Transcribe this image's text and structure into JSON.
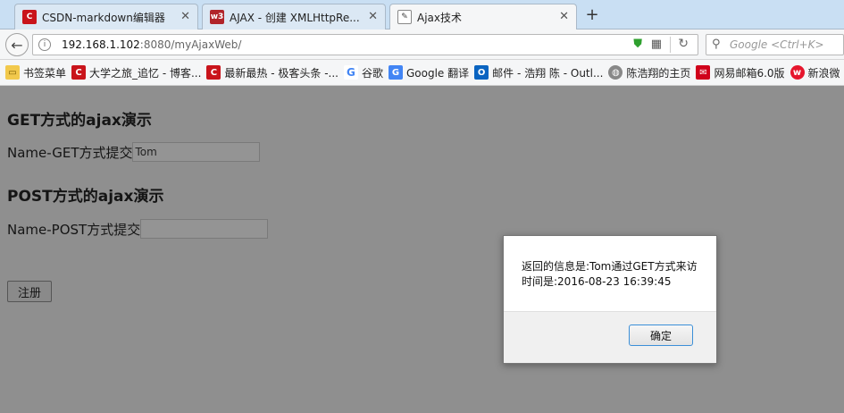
{
  "tabs": [
    {
      "label": "CSDN-markdown编辑器",
      "icon": "csdn-icon",
      "color": "#c9141b"
    },
    {
      "label": "AJAX - 创建 XMLHttpRe...",
      "icon": "w3-icon",
      "color": "#b1242a"
    },
    {
      "label": "Ajax技术",
      "icon": "page-icon",
      "color": "#444444"
    }
  ],
  "nav": {
    "url_host": "192.168.1.102",
    "url_rest": ":8080/myAjaxWeb/",
    "search_placeholder": "Google <Ctrl+K>"
  },
  "bookmarks": [
    {
      "label": "书签菜单",
      "icon": "folder-icon"
    },
    {
      "label": "大学之旅_追忆 - 博客...",
      "icon": "csdn-icon"
    },
    {
      "label": "最新最热 - 极客头条 -...",
      "icon": "csdn-icon"
    },
    {
      "label": "谷歌",
      "icon": "google-icon"
    },
    {
      "label": "Google 翻译",
      "icon": "translate-icon"
    },
    {
      "label": "邮件 - 浩翔 陈 - Outl...",
      "icon": "outlook-icon"
    },
    {
      "label": "陈浩翔的主页",
      "icon": "globe-icon"
    },
    {
      "label": "网易邮箱6.0版",
      "icon": "netease-icon"
    },
    {
      "label": "新浪微",
      "icon": "weibo-icon"
    }
  ],
  "page": {
    "get_heading": "GET方式的ajax演示",
    "get_label": "Name-GET方式提交",
    "get_value": "Tom",
    "post_heading": "POST方式的ajax演示",
    "post_label": "Name-POST方式提交",
    "post_value": "",
    "register_label": "注册"
  },
  "dialog": {
    "line1": "返回的信息是:Tom通过GET方式来访",
    "line2": "时间是:2016-08-23 16:39:45",
    "ok_label": "确定"
  },
  "colors": {
    "overlay": "#8f8f8f",
    "accent": "#3b8fd8",
    "tabstrip": "#c9dff3"
  }
}
